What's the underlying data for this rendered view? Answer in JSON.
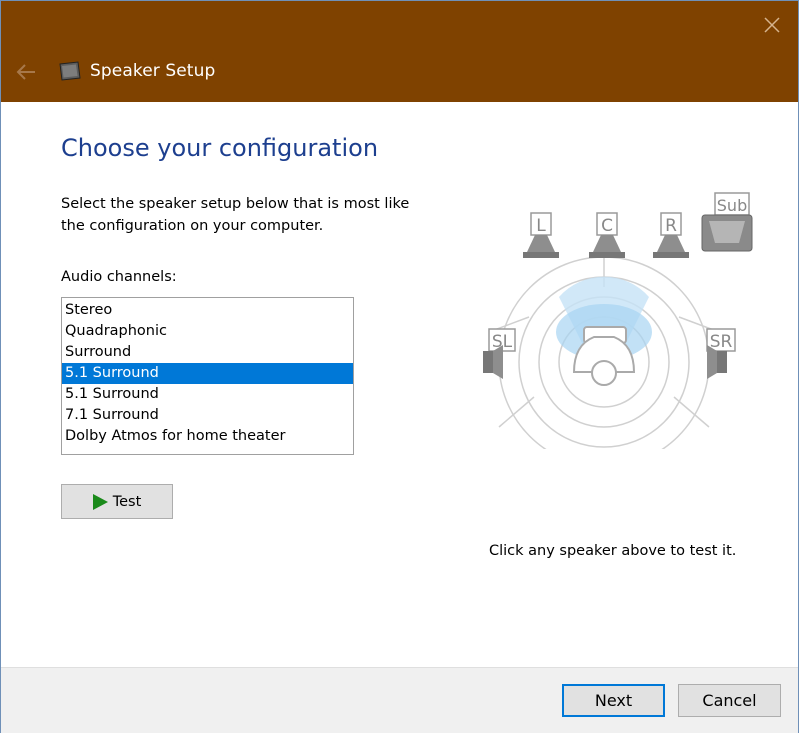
{
  "window": {
    "title": "Speaker Setup",
    "title_bar_color": "#7f4200"
  },
  "icons": {
    "back": "back-arrow-icon",
    "close": "close-icon",
    "app": "speaker-icon",
    "test": "play-icon"
  },
  "main": {
    "heading": "Choose your configuration",
    "instructions": "Select the speaker setup below that is most like the configuration on your computer.",
    "channels_label": "Audio channels:",
    "channels": [
      "Stereo",
      "Quadraphonic",
      "Surround",
      "5.1 Surround",
      "5.1 Surround",
      "7.1 Surround",
      "Dolby Atmos for home theater"
    ],
    "selected_channel": "5.1 Surround",
    "test_label": "Test",
    "hint": "Click any speaker above to test it."
  },
  "speakers": {
    "left": "L",
    "center": "C",
    "right": "R",
    "subwoofer": "Sub",
    "surround_left": "SL",
    "surround_right": "SR"
  },
  "footer": {
    "next_label": "Next",
    "cancel_label": "Cancel"
  },
  "colors": {
    "heading": "#1d3f8f",
    "selection": "#0078d7",
    "play": "#1a8a1a"
  }
}
